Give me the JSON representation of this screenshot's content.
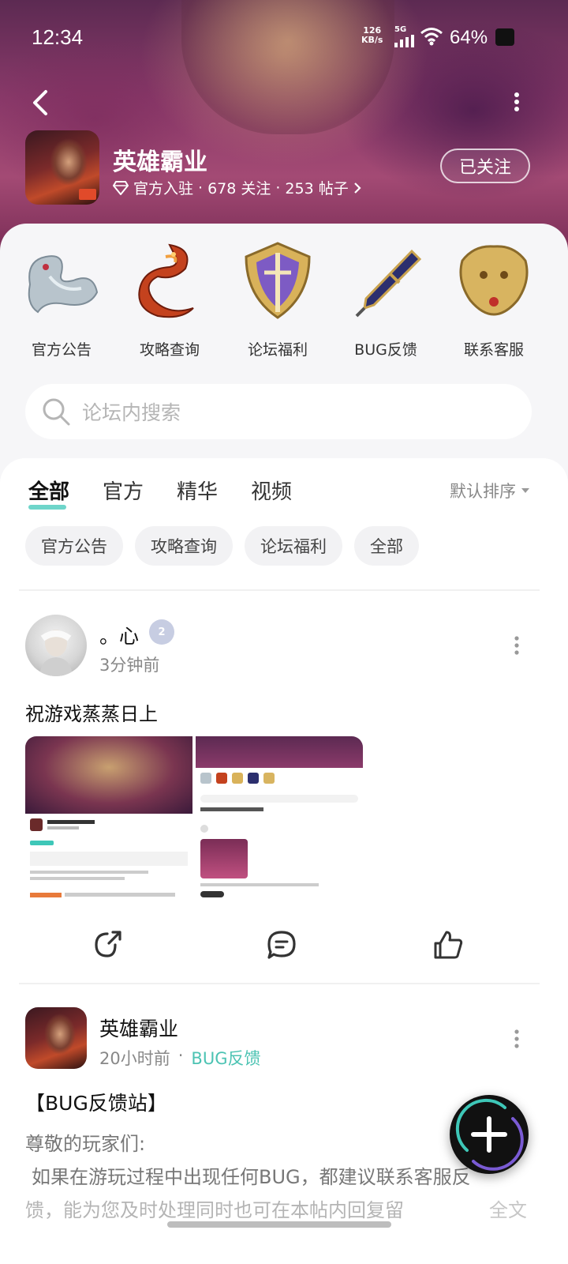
{
  "status_bar": {
    "time": "12:34",
    "net_speed_top": "126",
    "net_speed_unit": "KB/s",
    "network": "5G",
    "battery": "64%"
  },
  "header": {
    "title": "英雄霸业",
    "meta_official": "官方入驻",
    "meta_follow": "678 关注",
    "meta_posts": "253 帖子",
    "sep": "·",
    "follow_button": "已关注"
  },
  "quick_links": [
    {
      "label": "官方公告",
      "icon": "silver-dragon-icon"
    },
    {
      "label": "攻略查询",
      "icon": "fire-dragon-icon"
    },
    {
      "label": "论坛福利",
      "icon": "gold-shield-icon"
    },
    {
      "label": "BUG反馈",
      "icon": "pen-icon"
    },
    {
      "label": "联系客服",
      "icon": "gold-lion-icon"
    }
  ],
  "search": {
    "placeholder": "论坛内搜索"
  },
  "tabs": [
    "全部",
    "官方",
    "精华",
    "视频"
  ],
  "sort": {
    "label": "默认排序"
  },
  "chips": [
    "官方公告",
    "攻略查询",
    "论坛福利",
    "全部"
  ],
  "posts": [
    {
      "user": "。心",
      "level": "2",
      "time": "3分钟前",
      "text": "祝游戏蒸蒸日上"
    },
    {
      "user": "英雄霸业",
      "time": "20小时前",
      "sep": "·",
      "category": "BUG反馈",
      "title": "【BUG反馈站】",
      "body_line1": "尊敬的玩家们:",
      "body_line2": "如果在游玩过程中出现任何BUG，都建议联系客服反",
      "body_line3": "馈，能为您及时处理同时也可在本帖内回复留",
      "more": "全文"
    }
  ],
  "colors": {
    "accent": "#3ec7b8",
    "category": "#4cc3b3"
  }
}
